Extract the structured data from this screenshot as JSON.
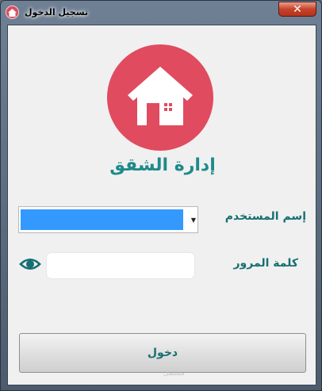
{
  "window": {
    "title": "تسجيل الدخول",
    "close_glyph": "✕",
    "icon": "house-icon"
  },
  "header": {
    "logo_icon": "house-icon",
    "logo_color": "#e04b5f",
    "app_title": "إدارة الشقق"
  },
  "form": {
    "username_label": "إسم المستخدم",
    "username_selected": "",
    "password_label": "كلمة المرور",
    "password_value": "",
    "password_toggle_icon": "eye-icon",
    "login_label": "دخول"
  },
  "colors": {
    "accent": "#176f73",
    "selection": "#3399ff"
  },
  "watermark": "مستقل"
}
